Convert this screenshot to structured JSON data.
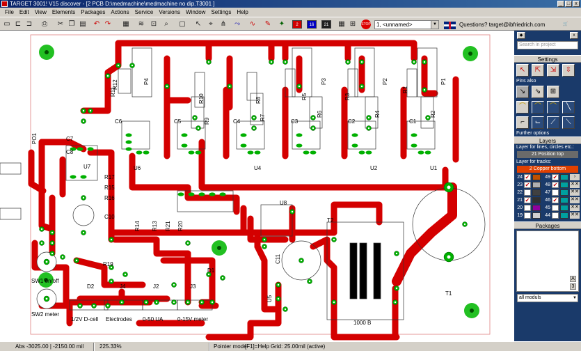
{
  "window": {
    "title": "TARGET 3001! V15 discover - [2 PCB D:\\medmachine\\medmachine no dip.T3001 ]",
    "buttons": [
      "_",
      "□",
      "x"
    ]
  },
  "menu": [
    "File",
    "Edit",
    "View",
    "Elements",
    "Packages",
    "Actions",
    "Service",
    "Versions",
    "Window",
    "Settings",
    "Help"
  ],
  "toolbar": {
    "layer_buttons": [
      {
        "label": "2",
        "color": "#d00000"
      },
      {
        "label": "16",
        "color": "#0000c0"
      },
      {
        "label": "21",
        "color": "#202020"
      }
    ],
    "stop_label": "STOP",
    "combo_value": "1, <unnamed>",
    "question_text": "Questions? target@ibfriedrich.com"
  },
  "pcb": {
    "board_color": "#ffffff",
    "track_color": "#d40000",
    "pad_color": "#00b000",
    "labels": [
      "P4",
      "P3",
      "P2",
      "P1",
      "R12",
      "R10",
      "R8",
      "R5",
      "R3",
      "R1",
      "R11",
      "R9",
      "R7",
      "R6",
      "R4",
      "R2",
      "C7",
      "C6",
      "C8",
      "C5",
      "C4",
      "C3",
      "C2",
      "C1",
      "U6",
      "U4",
      "U2",
      "U1",
      "PO1",
      "U7",
      "R17",
      "R15",
      "R16",
      "R14",
      "R13",
      "U8",
      "R20",
      "R21",
      "C10",
      "C11",
      "U5",
      "T2",
      "T1",
      "SW1 on/off",
      "SW2 meter",
      "R19",
      "D2",
      "J4",
      "J2",
      "J3",
      "D1",
      "1/2V D-cell",
      "Electrodes",
      "0-50 UA",
      "0-15V meter",
      "1000 B"
    ]
  },
  "sidebar": {
    "search_placeholder": "Search in project",
    "settings_header": "Settings",
    "pins_also": "Pins also",
    "further_options": "Further options",
    "layers_header": "Layers",
    "layer_for_lines": "Layer for lines, circles etc.:",
    "position_top": "21 Position top",
    "layer_for_tracks": "Layer for tracks:",
    "copper_bottom": "2 Copper bottom",
    "layers": [
      {
        "a": "24",
        "b": "49",
        "color": "#c05000",
        "checked": true
      },
      {
        "a": "23",
        "b": "48",
        "color": "#b0b0b0",
        "checked": true
      },
      {
        "a": "22",
        "b": "47",
        "color": "#404040",
        "checked": false
      },
      {
        "a": "21",
        "b": "46",
        "color": "#303030",
        "checked": true
      },
      {
        "a": "20",
        "b": "45",
        "color": "#9000a0",
        "checked": false
      },
      {
        "a": "19",
        "b": "44",
        "color": "#d0d0d0",
        "checked": false
      }
    ],
    "packages_header": "Packages",
    "pkg_letter_a": "A",
    "pkg_letter_b": "3",
    "all_moduls": "all moduls"
  },
  "status": {
    "coords": "Abs -3025.00 | -2150.00 mil",
    "zoom": "225.33%",
    "mode": "Pointer mode",
    "help": "[F1]=Help",
    "grid": "Grid: 25.00mil (active)"
  }
}
